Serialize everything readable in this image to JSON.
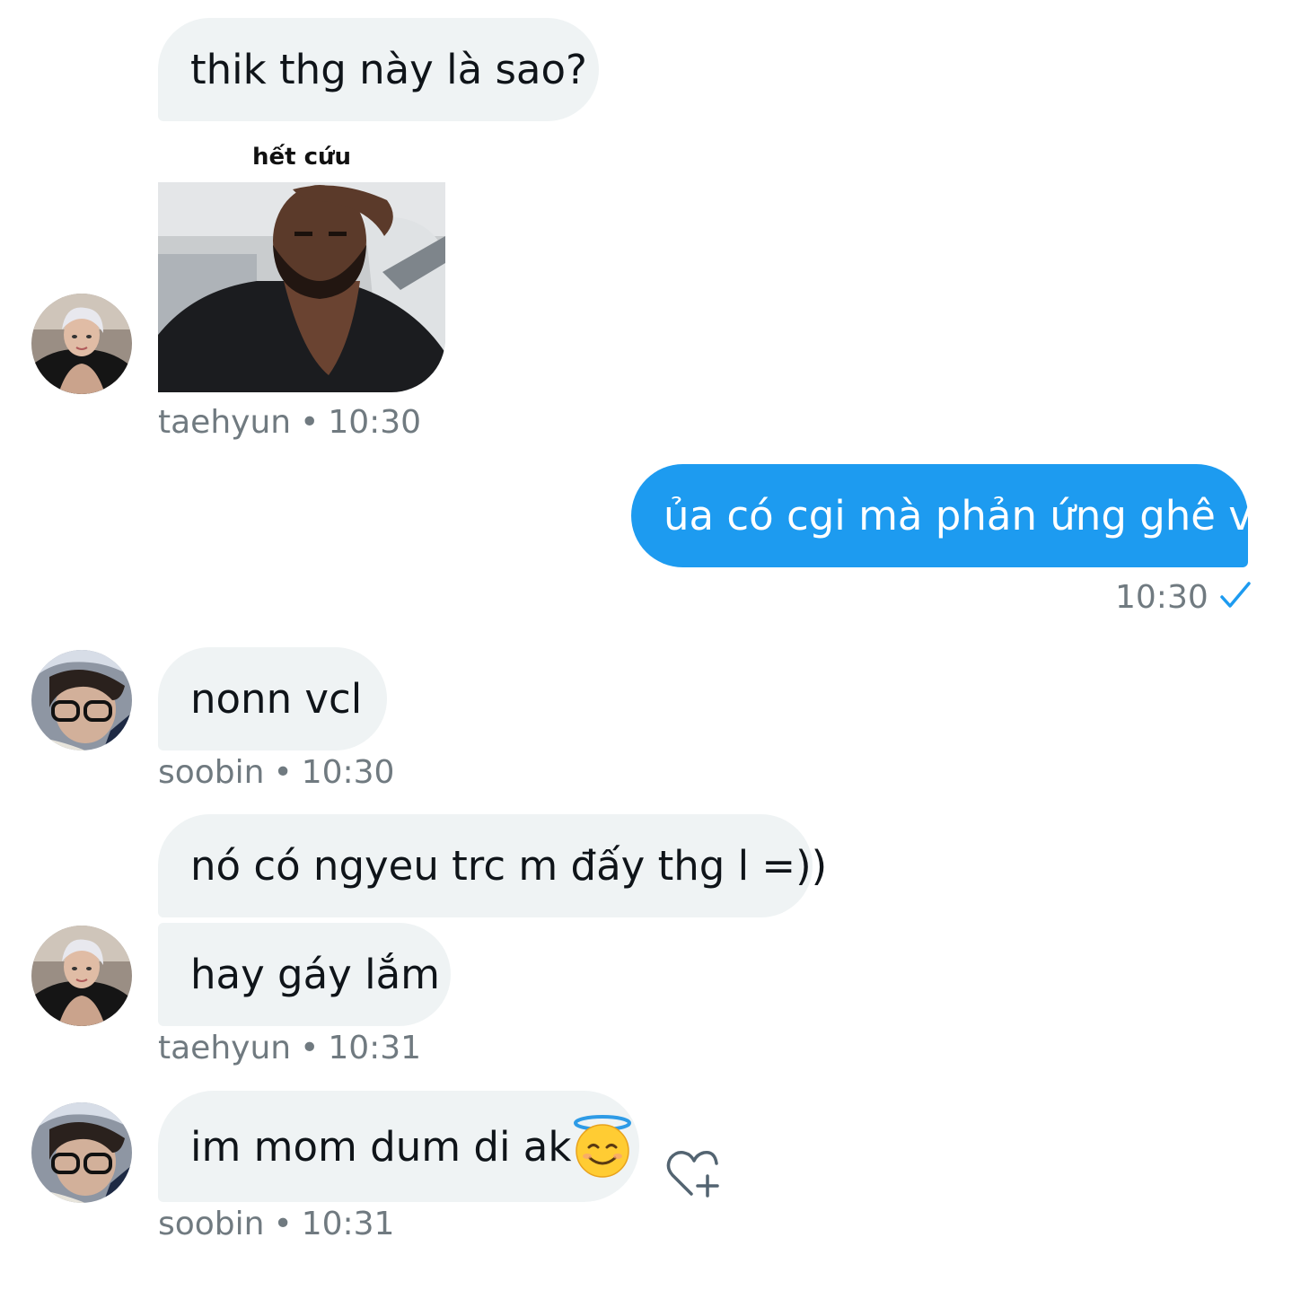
{
  "colors": {
    "incoming_bubble": "#eff3f4",
    "outgoing_bubble": "#1d9bf0",
    "meta_text": "#707a80",
    "check": "#1d9bf0"
  },
  "messages": [
    {
      "text": "thik thg này là sao?"
    },
    {
      "media_caption": "hết cứu",
      "meta_user": "taehyun",
      "meta_time": "10:30"
    },
    {
      "text": "ủa có cgi mà phản ứng ghê v",
      "meta_time": "10:30"
    },
    {
      "text": "nonn vcl",
      "meta_user": "soobin",
      "meta_time": "10:30"
    },
    {
      "text": "nó có ngyeu trc m đấy thg l =))"
    },
    {
      "text": "hay gáy lắm",
      "meta_user": "taehyun",
      "meta_time": "10:31"
    },
    {
      "text": "im mom dum di ak",
      "emoji": "smiling-face-with-halo",
      "meta_user": "soobin",
      "meta_time": "10:31"
    }
  ],
  "meta_separator": "•",
  "icons": {
    "read_receipt": "check-icon",
    "add_reaction": "heart-plus-icon"
  }
}
